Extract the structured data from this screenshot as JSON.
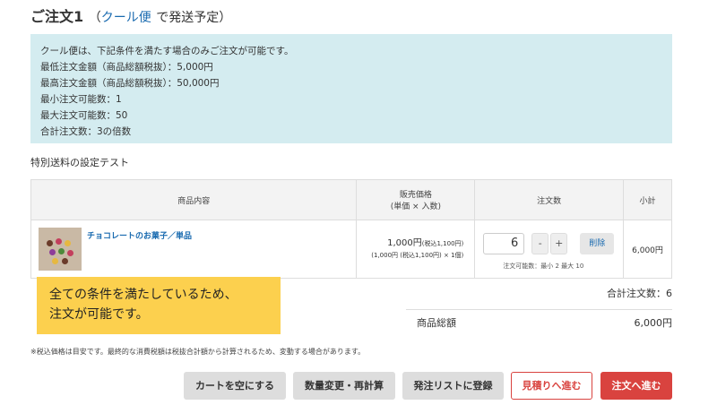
{
  "header": {
    "title": "ご注文1",
    "paren_open": "（",
    "shipping_link": "クール便",
    "suffix": "で発送予定）"
  },
  "notice": {
    "lines": [
      "クール便は、下記条件を満たす場合のみご注文が可能です。",
      "最低注文金額（商品総額税抜）：5,000円",
      "最高注文金額（商品総額税抜）：50,000円",
      "最小注文可能数：1",
      "最大注文可能数：50",
      "合計注文数：3の倍数"
    ]
  },
  "section_label": "特別送料の設定テスト",
  "table": {
    "headers": {
      "product": "商品内容",
      "price_line1": "販売価格",
      "price_line2": "(単価 × 入数)",
      "quantity": "注文数",
      "subtotal": "小計"
    },
    "rows": [
      {
        "name": "チョコレートのお菓子／単品",
        "price_main": "1,000円",
        "price_main_tax": "(税込1,100円)",
        "price_sub": "(1,000円 (税込1,100円) × 1個)",
        "quantity": "6",
        "minus": "-",
        "plus": "+",
        "delete": "削除",
        "qty_note": "注文可能数：最小 2  最大 10",
        "subtotal": "6,000円"
      }
    ]
  },
  "summary": {
    "total_qty": "合計注文数：6",
    "goods_total_label": "商品総額",
    "goods_total_value": "6,000円"
  },
  "callout": {
    "line1": "全ての条件を満たしているため、",
    "line2": "注文が可能です。"
  },
  "tax_note": "※税込価格は目安です。最終的な消費税額は税抜合計額から計算されるため、変動する場合があります。",
  "buttons": {
    "empty_cart": "カートを空にする",
    "recalc": "数量変更・再計算",
    "add_list": "発注リストに登録",
    "quote": "見積りへ進む",
    "order": "注文へ進む"
  },
  "colors": {
    "link": "#1a6bb0",
    "notice_bg": "#d4ecf0",
    "callout_bg": "#fcd04e",
    "accent_red": "#d9433f"
  }
}
